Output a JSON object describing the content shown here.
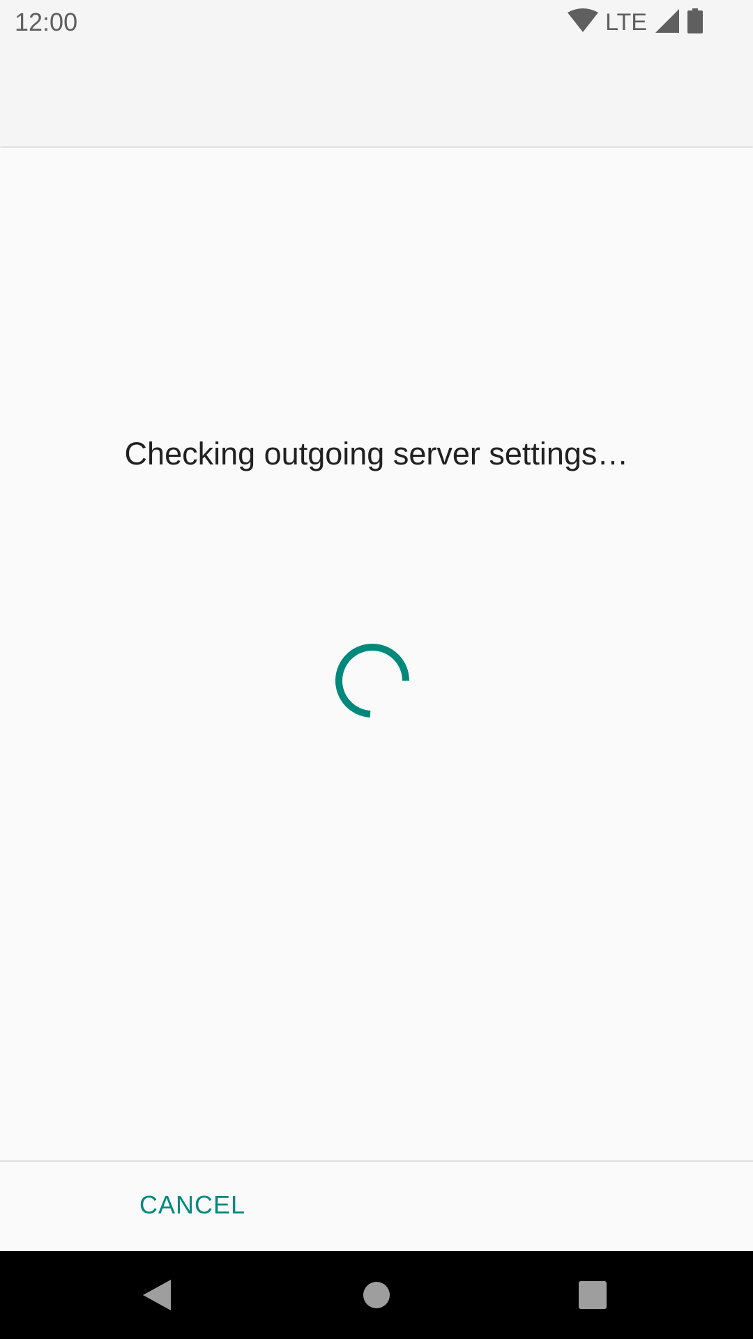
{
  "status_bar": {
    "time": "12:00",
    "network": "LTE",
    "icons": [
      "wifi-icon",
      "signal-icon",
      "battery-icon"
    ]
  },
  "dialog": {
    "message": "Checking outgoing server settings…",
    "progress": "indeterminate",
    "cancel_label": "CANCEL"
  },
  "nav_bar": {
    "buttons": [
      "back-icon",
      "home-icon",
      "recents-icon"
    ]
  },
  "colors": {
    "accent": "#00897b",
    "background": "#fafafa",
    "bar_background": "#f5f5f5",
    "nav_background": "#000000"
  }
}
